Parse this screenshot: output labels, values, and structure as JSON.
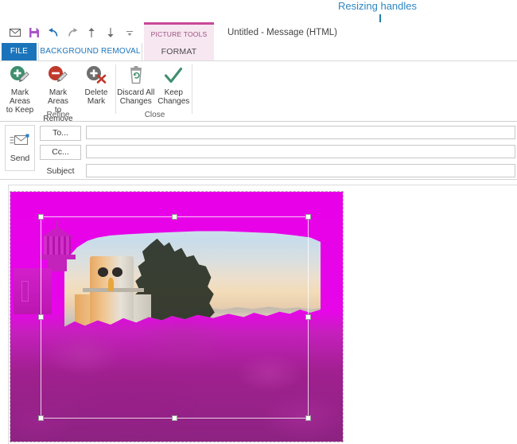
{
  "annotation": {
    "label": "Resizing handles",
    "color": "#2e86c1"
  },
  "window": {
    "title": "Untitled - Message (HTML)"
  },
  "quick_access_toolbar": {
    "items": [
      {
        "name": "envelope-icon",
        "tooltip": "Send"
      },
      {
        "name": "save-icon",
        "tooltip": "Save"
      },
      {
        "name": "undo-icon",
        "tooltip": "Undo"
      },
      {
        "name": "redo-icon",
        "tooltip": "Redo"
      },
      {
        "name": "previous-item-icon",
        "tooltip": "Previous Item"
      },
      {
        "name": "next-item-icon",
        "tooltip": "Next Item"
      },
      {
        "name": "customize-qat-icon",
        "tooltip": "Customize Quick Access Toolbar"
      }
    ]
  },
  "contextual_tab": {
    "banner": "PICTURE TOOLS",
    "format_label": "FORMAT"
  },
  "tabs": {
    "file": "FILE",
    "background_removal": "BACKGROUND REMOVAL",
    "format": "FORMAT",
    "active": "BACKGROUND REMOVAL"
  },
  "ribbon": {
    "groups": [
      {
        "label": "Refine",
        "buttons": [
          {
            "caption": "Mark Areas\nto Keep",
            "icon": "mark-keep-icon"
          },
          {
            "caption": "Mark Areas\nto Remove",
            "icon": "mark-remove-icon"
          },
          {
            "caption": "Delete\nMark",
            "icon": "delete-mark-icon"
          }
        ]
      },
      {
        "label": "Close",
        "buttons": [
          {
            "caption": "Discard All\nChanges",
            "icon": "discard-changes-icon"
          },
          {
            "caption": "Keep\nChanges",
            "icon": "keep-changes-icon"
          }
        ]
      }
    ]
  },
  "message": {
    "send_label": "Send",
    "to_label": "To...",
    "cc_label": "Cc...",
    "subject_label": "Subject",
    "to_value": "",
    "cc_value": "",
    "subject_value": ""
  },
  "picture": {
    "state": "background-removal-preview",
    "removal_overlay_color": "#e800e8",
    "selection_handle_count": 8,
    "handles": [
      "top-left",
      "top-middle",
      "top-right",
      "middle-left",
      "middle-right",
      "bottom-left",
      "bottom-middle",
      "bottom-right"
    ],
    "subject": "Lighthouse at sunset"
  }
}
